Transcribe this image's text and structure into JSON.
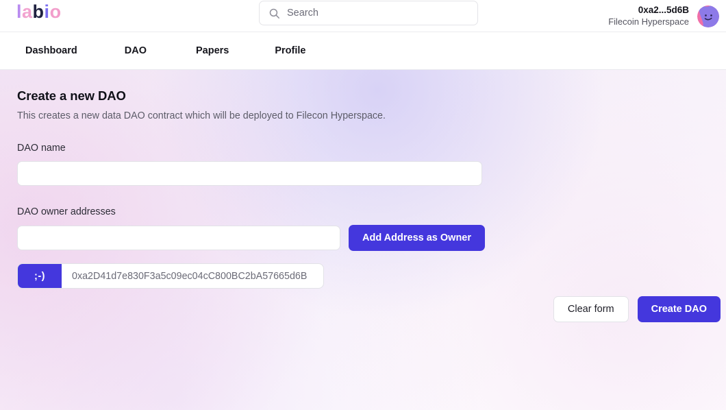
{
  "header": {
    "logo": {
      "letters": [
        "l",
        "a",
        "b",
        "i",
        "o"
      ]
    },
    "search": {
      "placeholder": "Search",
      "value": "",
      "icon": "search-icon"
    },
    "account": {
      "address": "0xa2...5d6B",
      "network": "Filecoin Hyperspace",
      "avatar_icon": "smiley-avatar"
    }
  },
  "nav": {
    "items": [
      {
        "label": "Dashboard"
      },
      {
        "label": "DAO"
      },
      {
        "label": "Papers"
      },
      {
        "label": "Profile"
      }
    ]
  },
  "main": {
    "title": "Create a new DAO",
    "subtitle": "This creates a new data DAO contract which will be deployed to Filecon Hyperspace.",
    "dao_name": {
      "label": "DAO name",
      "value": "",
      "placeholder": ""
    },
    "owner_addresses": {
      "label": "DAO owner addresses",
      "value": "",
      "placeholder": "",
      "add_button_label": "Add Address as Owner",
      "chips": [
        {
          "badge": ";-)",
          "address": "0xa2D41d7e830F3a5c09ec04cC800BC2bA57665d6B"
        }
      ]
    },
    "actions": {
      "clear_label": "Clear form",
      "create_label": "Create DAO"
    }
  },
  "colors": {
    "accent": "#4437dd",
    "text_primary": "#15151c",
    "text_muted": "#5c5c68",
    "border": "#e2e2e7"
  }
}
